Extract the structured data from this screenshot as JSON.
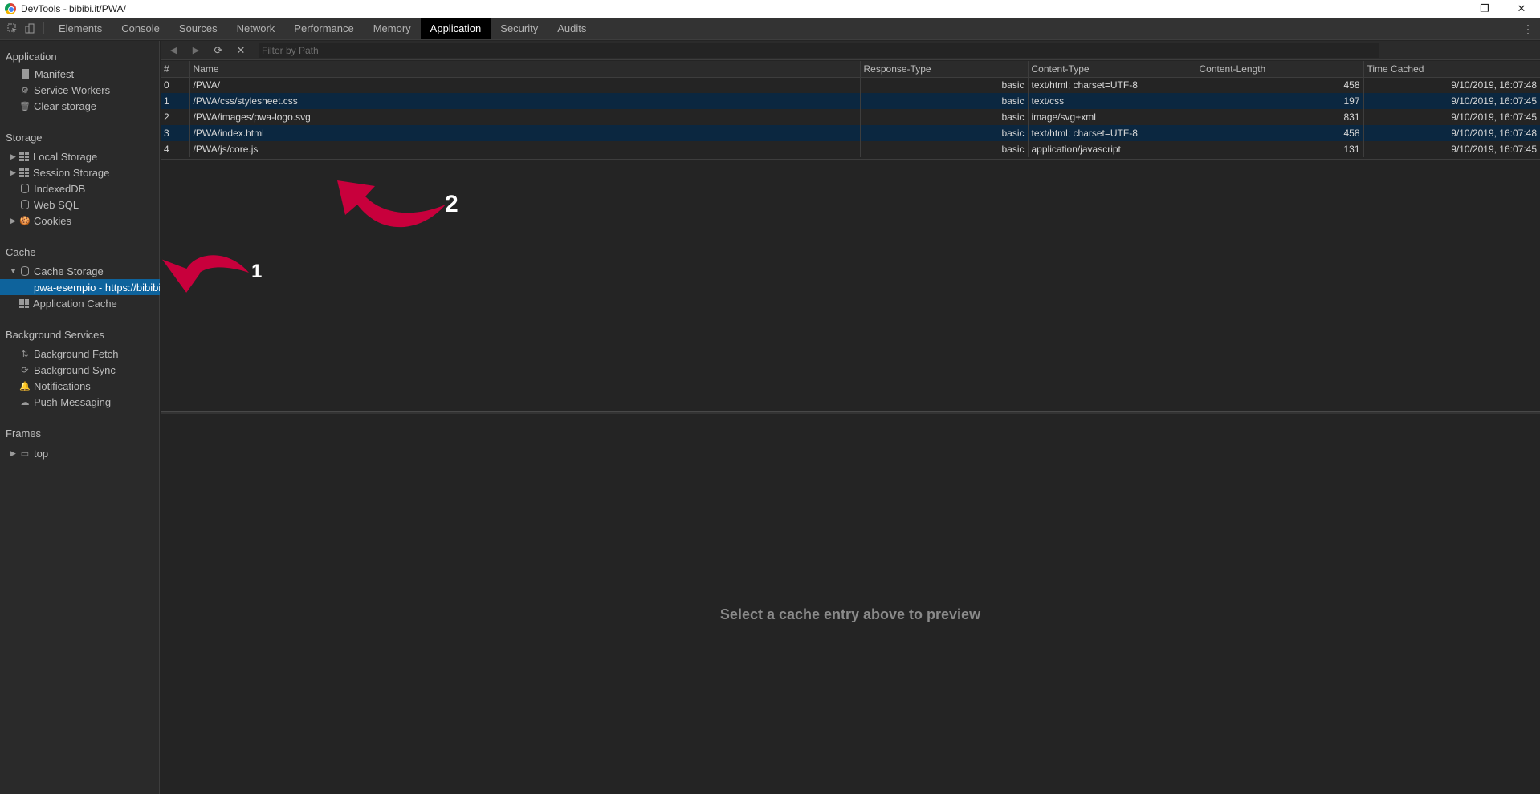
{
  "window": {
    "title": "DevTools - bibibi.it/PWA/",
    "minimize": "—",
    "restore": "❐",
    "close": "✕"
  },
  "tabs": [
    "Elements",
    "Console",
    "Sources",
    "Network",
    "Performance",
    "Memory",
    "Application",
    "Security",
    "Audits"
  ],
  "active_tab": "Application",
  "sidebar": {
    "application": {
      "title": "Application",
      "items": [
        "Manifest",
        "Service Workers",
        "Clear storage"
      ]
    },
    "storage": {
      "title": "Storage",
      "items": [
        "Local Storage",
        "Session Storage",
        "IndexedDB",
        "Web SQL",
        "Cookies"
      ]
    },
    "cache": {
      "title": "Cache",
      "cache_storage": "Cache Storage",
      "selected_entry": "pwa-esempio - https://bibibi.it",
      "application_cache": "Application Cache"
    },
    "background": {
      "title": "Background Services",
      "items": [
        "Background Fetch",
        "Background Sync",
        "Notifications",
        "Push Messaging"
      ]
    },
    "frames": {
      "title": "Frames",
      "items": [
        "top"
      ]
    }
  },
  "toolbar": {
    "filter_placeholder": "Filter by Path"
  },
  "table": {
    "columns": [
      "#",
      "Name",
      "Response-Type",
      "Content-Type",
      "Content-Length",
      "Time Cached"
    ],
    "rows": [
      [
        "0",
        "/PWA/",
        "basic",
        "text/html; charset=UTF-8",
        "458",
        "9/10/2019, 16:07:48"
      ],
      [
        "1",
        "/PWA/css/stylesheet.css",
        "basic",
        "text/css",
        "197",
        "9/10/2019, 16:07:45"
      ],
      [
        "2",
        "/PWA/images/pwa-logo.svg",
        "basic",
        "image/svg+xml",
        "831",
        "9/10/2019, 16:07:45"
      ],
      [
        "3",
        "/PWA/index.html",
        "basic",
        "text/html; charset=UTF-8",
        "458",
        "9/10/2019, 16:07:48"
      ],
      [
        "4",
        "/PWA/js/core.js",
        "basic",
        "application/javascript",
        "131",
        "9/10/2019, 16:07:45"
      ]
    ]
  },
  "preview": {
    "message": "Select a cache entry above to preview"
  },
  "annotations": {
    "arrow1_label": "1",
    "arrow2_label": "2",
    "arrow_color": "#c8003c"
  }
}
